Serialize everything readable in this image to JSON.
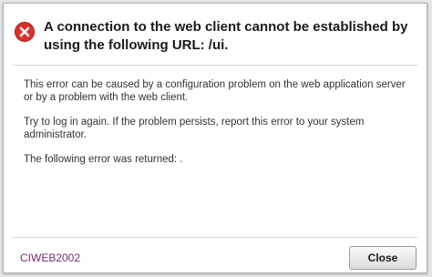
{
  "dialog": {
    "icon": "error-circle-x-icon",
    "icon_color": "#d9322b",
    "title": "A connection to the web client cannot be established by using the following URL: /ui.",
    "message_1": "This error can be caused by a configuration problem on the web application server or by a problem with the web client.",
    "message_2": "Try to log in again. If the problem persists, report this error to your system administrator.",
    "message_3": "The following error was returned: .",
    "error_code": "CIWEB2002",
    "error_code_color": "#7a2a7a",
    "close_label": "Close"
  }
}
